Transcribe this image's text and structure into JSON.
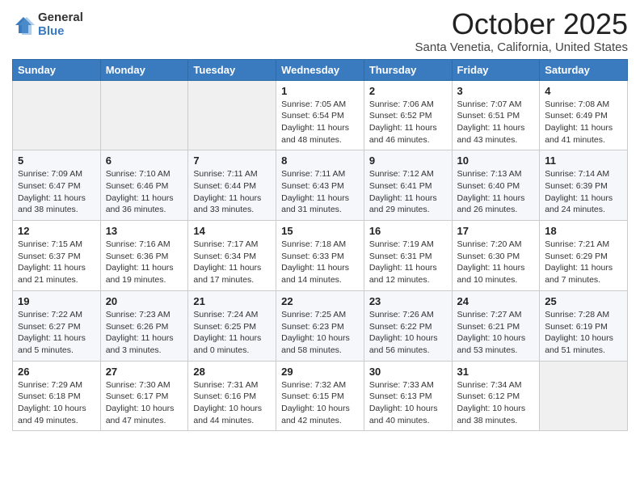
{
  "logo": {
    "general": "General",
    "blue": "Blue"
  },
  "title": "October 2025",
  "subtitle": "Santa Venetia, California, United States",
  "days_of_week": [
    "Sunday",
    "Monday",
    "Tuesday",
    "Wednesday",
    "Thursday",
    "Friday",
    "Saturday"
  ],
  "weeks": [
    [
      {
        "day": "",
        "info": ""
      },
      {
        "day": "",
        "info": ""
      },
      {
        "day": "",
        "info": ""
      },
      {
        "day": "1",
        "info": "Sunrise: 7:05 AM\nSunset: 6:54 PM\nDaylight: 11 hours and 48 minutes."
      },
      {
        "day": "2",
        "info": "Sunrise: 7:06 AM\nSunset: 6:52 PM\nDaylight: 11 hours and 46 minutes."
      },
      {
        "day": "3",
        "info": "Sunrise: 7:07 AM\nSunset: 6:51 PM\nDaylight: 11 hours and 43 minutes."
      },
      {
        "day": "4",
        "info": "Sunrise: 7:08 AM\nSunset: 6:49 PM\nDaylight: 11 hours and 41 minutes."
      }
    ],
    [
      {
        "day": "5",
        "info": "Sunrise: 7:09 AM\nSunset: 6:47 PM\nDaylight: 11 hours and 38 minutes."
      },
      {
        "day": "6",
        "info": "Sunrise: 7:10 AM\nSunset: 6:46 PM\nDaylight: 11 hours and 36 minutes."
      },
      {
        "day": "7",
        "info": "Sunrise: 7:11 AM\nSunset: 6:44 PM\nDaylight: 11 hours and 33 minutes."
      },
      {
        "day": "8",
        "info": "Sunrise: 7:11 AM\nSunset: 6:43 PM\nDaylight: 11 hours and 31 minutes."
      },
      {
        "day": "9",
        "info": "Sunrise: 7:12 AM\nSunset: 6:41 PM\nDaylight: 11 hours and 29 minutes."
      },
      {
        "day": "10",
        "info": "Sunrise: 7:13 AM\nSunset: 6:40 PM\nDaylight: 11 hours and 26 minutes."
      },
      {
        "day": "11",
        "info": "Sunrise: 7:14 AM\nSunset: 6:39 PM\nDaylight: 11 hours and 24 minutes."
      }
    ],
    [
      {
        "day": "12",
        "info": "Sunrise: 7:15 AM\nSunset: 6:37 PM\nDaylight: 11 hours and 21 minutes."
      },
      {
        "day": "13",
        "info": "Sunrise: 7:16 AM\nSunset: 6:36 PM\nDaylight: 11 hours and 19 minutes."
      },
      {
        "day": "14",
        "info": "Sunrise: 7:17 AM\nSunset: 6:34 PM\nDaylight: 11 hours and 17 minutes."
      },
      {
        "day": "15",
        "info": "Sunrise: 7:18 AM\nSunset: 6:33 PM\nDaylight: 11 hours and 14 minutes."
      },
      {
        "day": "16",
        "info": "Sunrise: 7:19 AM\nSunset: 6:31 PM\nDaylight: 11 hours and 12 minutes."
      },
      {
        "day": "17",
        "info": "Sunrise: 7:20 AM\nSunset: 6:30 PM\nDaylight: 11 hours and 10 minutes."
      },
      {
        "day": "18",
        "info": "Sunrise: 7:21 AM\nSunset: 6:29 PM\nDaylight: 11 hours and 7 minutes."
      }
    ],
    [
      {
        "day": "19",
        "info": "Sunrise: 7:22 AM\nSunset: 6:27 PM\nDaylight: 11 hours and 5 minutes."
      },
      {
        "day": "20",
        "info": "Sunrise: 7:23 AM\nSunset: 6:26 PM\nDaylight: 11 hours and 3 minutes."
      },
      {
        "day": "21",
        "info": "Sunrise: 7:24 AM\nSunset: 6:25 PM\nDaylight: 11 hours and 0 minutes."
      },
      {
        "day": "22",
        "info": "Sunrise: 7:25 AM\nSunset: 6:23 PM\nDaylight: 10 hours and 58 minutes."
      },
      {
        "day": "23",
        "info": "Sunrise: 7:26 AM\nSunset: 6:22 PM\nDaylight: 10 hours and 56 minutes."
      },
      {
        "day": "24",
        "info": "Sunrise: 7:27 AM\nSunset: 6:21 PM\nDaylight: 10 hours and 53 minutes."
      },
      {
        "day": "25",
        "info": "Sunrise: 7:28 AM\nSunset: 6:19 PM\nDaylight: 10 hours and 51 minutes."
      }
    ],
    [
      {
        "day": "26",
        "info": "Sunrise: 7:29 AM\nSunset: 6:18 PM\nDaylight: 10 hours and 49 minutes."
      },
      {
        "day": "27",
        "info": "Sunrise: 7:30 AM\nSunset: 6:17 PM\nDaylight: 10 hours and 47 minutes."
      },
      {
        "day": "28",
        "info": "Sunrise: 7:31 AM\nSunset: 6:16 PM\nDaylight: 10 hours and 44 minutes."
      },
      {
        "day": "29",
        "info": "Sunrise: 7:32 AM\nSunset: 6:15 PM\nDaylight: 10 hours and 42 minutes."
      },
      {
        "day": "30",
        "info": "Sunrise: 7:33 AM\nSunset: 6:13 PM\nDaylight: 10 hours and 40 minutes."
      },
      {
        "day": "31",
        "info": "Sunrise: 7:34 AM\nSunset: 6:12 PM\nDaylight: 10 hours and 38 minutes."
      },
      {
        "day": "",
        "info": ""
      }
    ]
  ]
}
